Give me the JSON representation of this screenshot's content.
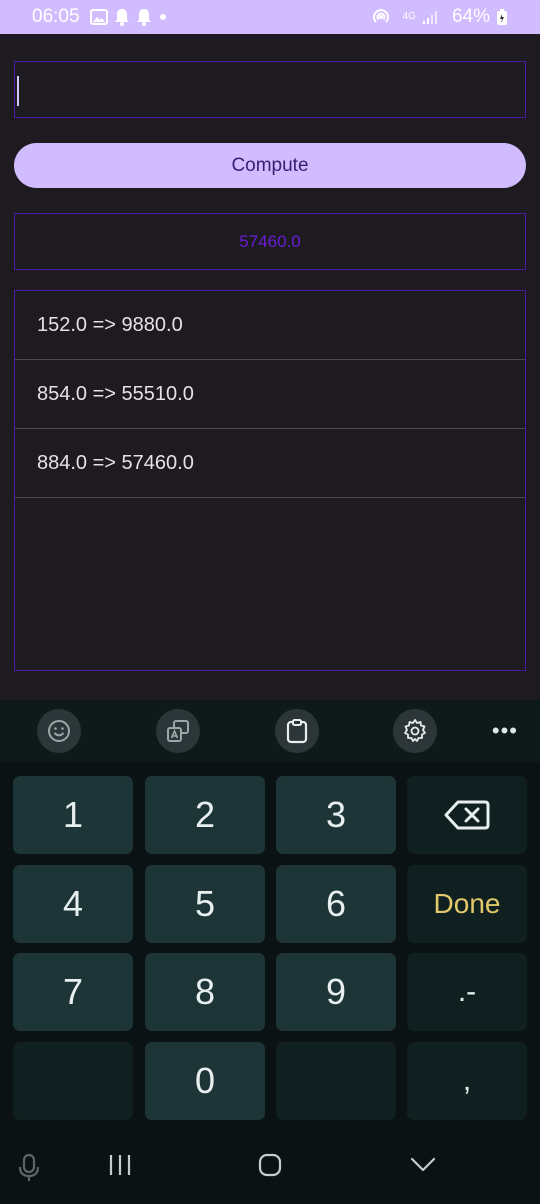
{
  "status_bar": {
    "time": "06:05",
    "network": "4G",
    "battery": "64%",
    "icons": [
      "image-icon",
      "bell-icon",
      "bell-icon",
      "dot-icon",
      "hotspot-icon",
      "signal-icon",
      "battery-icon"
    ]
  },
  "input": {
    "value": "",
    "placeholder": ""
  },
  "compute_button": {
    "label": "Compute"
  },
  "result": {
    "value": "57460.0"
  },
  "history": [
    {
      "text": "152.0 => 9880.0"
    },
    {
      "text": "854.0 => 55510.0"
    },
    {
      "text": "884.0 => 57460.0"
    }
  ],
  "keyboard": {
    "toolbar_icons": [
      "emoji-icon",
      "translate-icon",
      "clipboard-icon",
      "settings-icon",
      "more-icon"
    ],
    "keys": {
      "k1": "1",
      "k2": "2",
      "k3": "3",
      "k4": "4",
      "k5": "5",
      "k6": "6",
      "k7": "7",
      "k8": "8",
      "k9": "9",
      "k0": "0",
      "done": "Done",
      "dot_minus": ".-",
      "comma": ","
    },
    "done_color": "#e2c86a"
  },
  "colors": {
    "accent": "#d0bcff",
    "border": "#4a1aa0",
    "result_text": "#6a1cd6",
    "background": "#1d1b20"
  },
  "nav_bar": {
    "icons": [
      "mic-icon",
      "recents-icon",
      "home-icon",
      "back-icon"
    ]
  }
}
